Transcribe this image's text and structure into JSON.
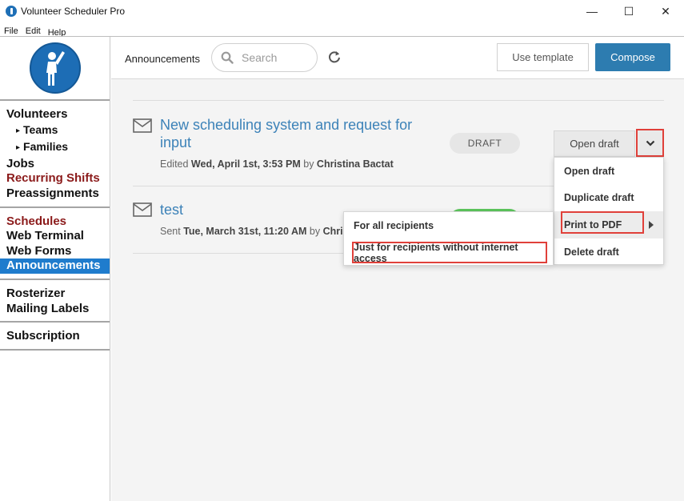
{
  "window": {
    "title": "Volunteer Scheduler Pro",
    "controls": {
      "minimize": "—",
      "maximize": "☐",
      "close": "✕"
    }
  },
  "menubar": [
    "File",
    "Edit",
    "Help"
  ],
  "sidebar": {
    "groups": [
      [
        {
          "label": "Volunteers",
          "style": "normal"
        },
        {
          "label": "Teams",
          "style": "sub"
        },
        {
          "label": "Families",
          "style": "sub"
        },
        {
          "label": "Jobs",
          "style": "normal"
        },
        {
          "label": "Recurring Shifts",
          "style": "dark-red"
        },
        {
          "label": "Preassignments",
          "style": "normal"
        }
      ],
      [
        {
          "label": "Schedules",
          "style": "dark-red"
        },
        {
          "label": "Web Terminal",
          "style": "normal"
        },
        {
          "label": "Web Forms",
          "style": "normal"
        },
        {
          "label": "Announcements",
          "style": "active"
        }
      ],
      [
        {
          "label": "Rosterizer",
          "style": "normal"
        },
        {
          "label": "Mailing Labels",
          "style": "normal"
        }
      ],
      [
        {
          "label": "Subscription",
          "style": "normal"
        }
      ]
    ]
  },
  "toolbar": {
    "title": "Announcements",
    "search_placeholder": "Search",
    "use_template_label": "Use template",
    "compose_label": "Compose"
  },
  "announcements": [
    {
      "title_line1": "New scheduling system and request for",
      "title_line2": "input",
      "meta_prefix": "Edited ",
      "meta_date": "Wed, April 1st, 3:53 PM",
      "meta_by": " by ",
      "meta_author": "Christina Bactat",
      "status": "DRAFT",
      "status_color": "#e6e6e6",
      "action_label": "Open draft"
    },
    {
      "title_line1": "test",
      "meta_prefix": "Sent ",
      "meta_date": "Tue, March 31st, 11:20 AM",
      "meta_by": " by ",
      "meta_author": "Christ",
      "status_color": "#5cc65c"
    }
  ],
  "dropdown_menu": {
    "items": [
      "Open draft",
      "Duplicate draft",
      "Print to PDF",
      "Delete draft"
    ]
  },
  "submenu": {
    "items": [
      "For all recipients",
      "Just for recipients without internet access"
    ]
  },
  "colors": {
    "accent": "#2d7cb0",
    "link": "#3c82b8",
    "highlight": "#e0403a",
    "sidebar_active": "#1f7ccd"
  }
}
